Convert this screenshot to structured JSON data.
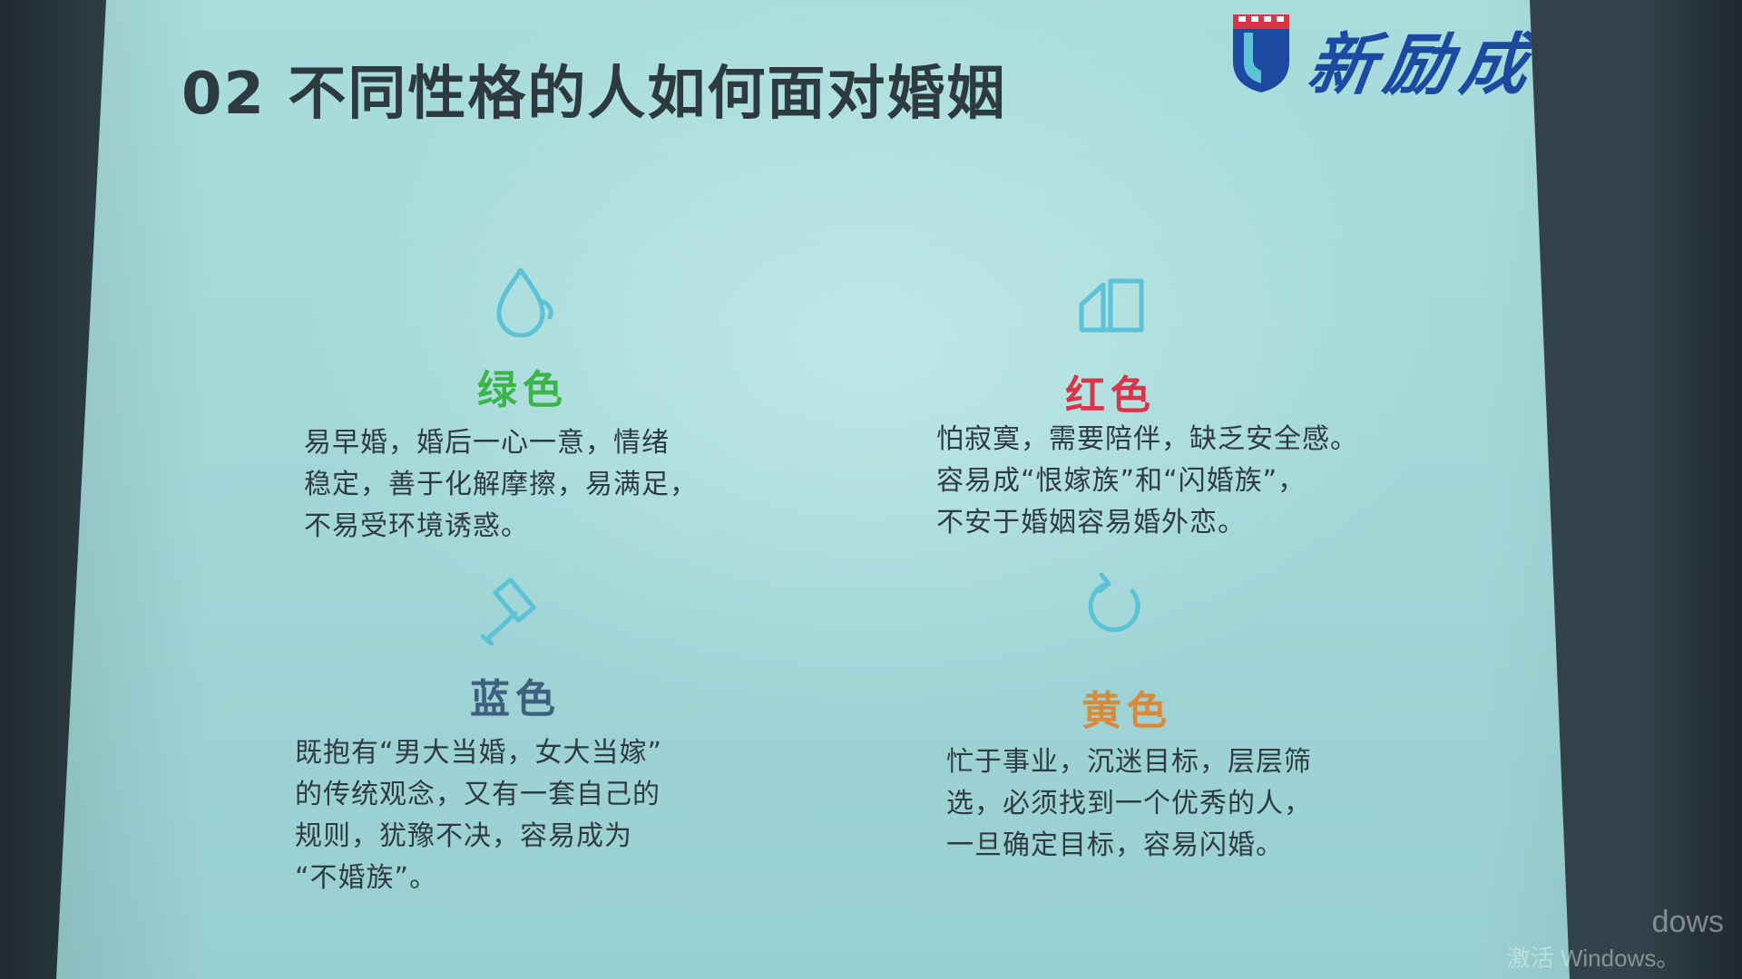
{
  "slide": {
    "title": "02 不同性格的人如何面对婚姻",
    "logo_text": "新励成"
  },
  "quadrants": [
    {
      "icon": "water-drop-icon",
      "heading": "绿色",
      "color": "#3bb54a",
      "lines": [
        "易早婚，婚后一心一意，情绪",
        "稳定，善于化解摩擦，易满足，",
        "不易受环境诱惑。"
      ]
    },
    {
      "icon": "shapes-icon",
      "heading": "红色",
      "color": "#d8344a",
      "lines": [
        "怕寂寞，需要陪伴，缺乏安全感。",
        "容易成“恨嫁族”和“闪婚族”，",
        "不安于婚姻容易婚外恋。"
      ]
    },
    {
      "icon": "paint-roller-icon",
      "heading": "蓝色",
      "color": "#3e5f7e",
      "lines": [
        "既抱有“男大当婚，女大当嫁”",
        "的传统观念，又有一套自己的",
        "规则，犹豫不决，容易成为",
        "“不婚族”。"
      ]
    },
    {
      "icon": "refresh-icon",
      "heading": "黄色",
      "color": "#d88a3a",
      "lines": [
        "忙于事业，沉迷目标，层层筛",
        "选，必须找到一个优秀的人，",
        "一旦确定目标，容易闪婚。"
      ]
    }
  ],
  "watermark": {
    "line1": "dows",
    "line2": "激活 Windows。"
  },
  "icon_color": "#5cc3d6"
}
